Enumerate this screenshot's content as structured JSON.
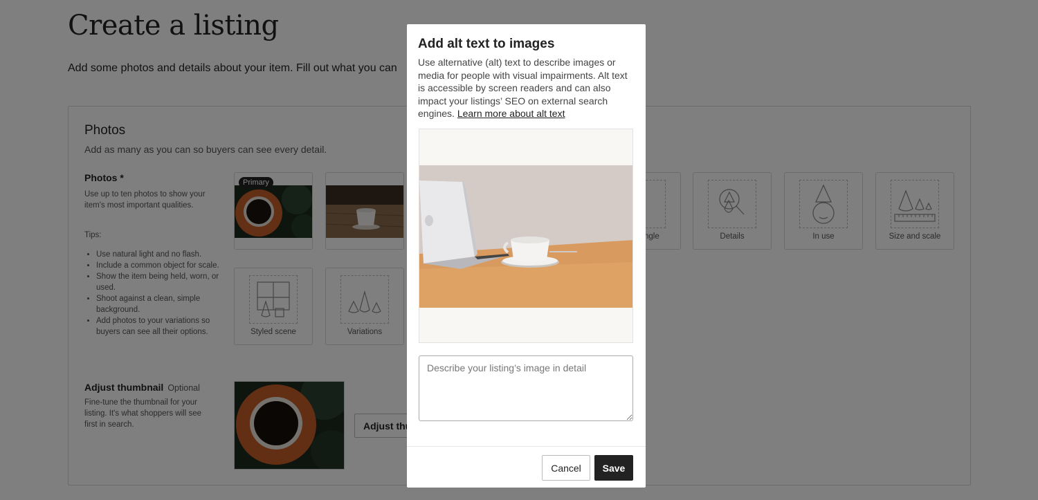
{
  "page": {
    "title": "Create a listing",
    "subtitle": "Add some photos and details about your item. Fill out what you can"
  },
  "photos_section": {
    "title": "Photos",
    "description": "Add as many as you can so buyers can see every detail.",
    "photos_label": "Photos *",
    "photos_help": "Use up to ten photos to show your item's most important qualities.",
    "tips_label": "Tips:",
    "tips": [
      "Use natural light and no flash.",
      "Include a common object for scale.",
      "Show the item being held, worn, or used.",
      "Shoot against a clean, simple background.",
      "Add photos to your variations so buyers can see all their options."
    ],
    "primary_badge": "Primary",
    "slots": [
      {
        "label": "ngle",
        "icon": "angle-icon"
      },
      {
        "label": "Details",
        "icon": "details-icon"
      },
      {
        "label": "In use",
        "icon": "in-use-icon"
      },
      {
        "label": "Size and scale",
        "icon": "size-and-scale-icon"
      },
      {
        "label": "Styled scene",
        "icon": "styled-scene-icon"
      },
      {
        "label": "Variations",
        "icon": "variations-icon"
      }
    ],
    "thumbnail": {
      "label": "Adjust thumbnail",
      "optional": "Optional",
      "help": "Fine-tune the thumbnail for your listing. It's what shoppers will see first in search.",
      "button": "Adjust thu"
    }
  },
  "modal": {
    "title": "Add alt text to images",
    "description": "Use alternative (alt) text to describe images or media for people with visual impairments. Alt text is accessible by screen readers and can also impact your listings’ SEO on external search engines.",
    "link": "Learn more about alt text",
    "input_placeholder": "Describe your listing’s image in detail",
    "input_value": "",
    "cancel": "Cancel",
    "save": "Save"
  },
  "colors": {
    "overlay": "#000000",
    "primary_button": "#222222",
    "text": "#222222"
  }
}
